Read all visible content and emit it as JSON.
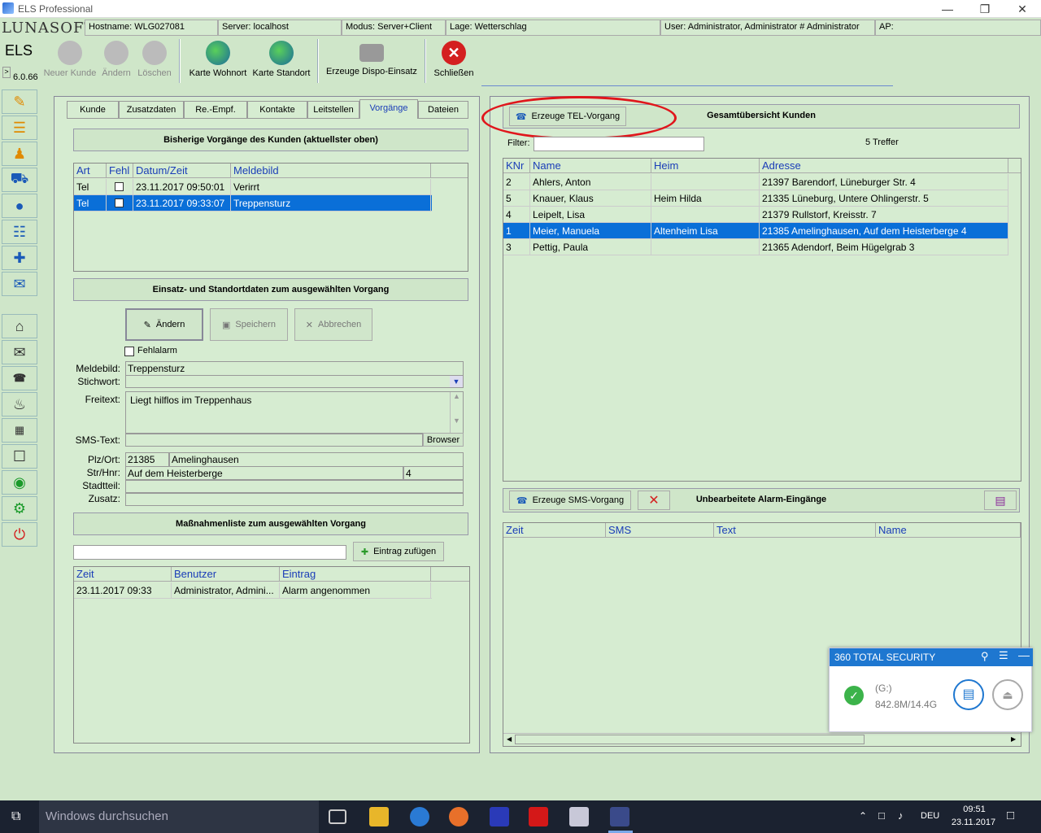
{
  "window": {
    "title": "ELS Professional"
  },
  "info": {
    "logo": "LUNASOFT",
    "hostname": "Hostname: WLG027081",
    "server": "Server: localhost",
    "modus": "Modus: Server+Client",
    "lage": "Lage: Wetterschlag",
    "user": "User: Administrator, Administrator # Administrator",
    "ap": "AP:"
  },
  "app": {
    "name": "ELS",
    "version": "6.0.66",
    "arrow": ">"
  },
  "toolbar": {
    "neuer_kunde": "Neuer Kunde",
    "aendern": "Ändern",
    "loeschen": "Löschen",
    "karte_wohnort": "Karte Wohnort",
    "karte_standort": "Karte Standort",
    "dispo": "Erzeuge Dispo-Einsatz",
    "schliessen": "Schließen"
  },
  "tabs": [
    "Kunde",
    "Zusatzdaten",
    "Re.-Empf.",
    "Kontakte",
    "Leitstellen",
    "Vorgänge",
    "Dateien"
  ],
  "vorgaenge": {
    "title": "Bisherige Vorgänge des Kunden (aktuellster oben)",
    "cols": [
      "Art",
      "Fehl",
      "Datum/Zeit",
      "Meldebild"
    ],
    "rows": [
      {
        "art": "Tel",
        "datum": "23.11.2017 09:50:01",
        "meldebild": "Verirrt"
      },
      {
        "art": "Tel",
        "datum": "23.11.2017 09:33:07",
        "meldebild": "Treppensturz"
      }
    ]
  },
  "einsatz": {
    "title": "Einsatz- und Standortdaten zum ausgewählten Vorgang",
    "aendern": "Ändern",
    "speichern": "Speichern",
    "abbrechen": "Abbrechen",
    "fehlalarm": "Fehlalarm",
    "meldebild_label": "Meldebild:",
    "meldebild": "Treppensturz",
    "stichwort_label": "Stichwort:",
    "freitext_label": "Freitext:",
    "freitext": "Liegt hilflos im Treppenhaus",
    "sms_label": "SMS-Text:",
    "browser": "Browser",
    "plz_label": "Plz/Ort:",
    "plz": "21385",
    "ort": "Amelinghausen",
    "str_label": "Str/Hnr:",
    "str": "Auf dem Heisterberge",
    "hnr": "4",
    "stadtteil_label": "Stadtteil:",
    "zusatz_label": "Zusatz:"
  },
  "massnahmen": {
    "title": "Maßnahmenliste zum ausgewählten Vorgang",
    "add": "Eintrag zufügen",
    "cols": [
      "Zeit",
      "Benutzer",
      "Eintrag"
    ],
    "rows": [
      {
        "zeit": "23.11.2017 09:33",
        "benutzer": "Administrator, Admini...",
        "eintrag": "Alarm angenommen"
      }
    ]
  },
  "uebersicht": {
    "tel_button": "Erzeuge TEL-Vorgang",
    "title": "Gesamtübersicht Kunden",
    "filter_label": "Filter:",
    "treffer": "5 Treffer",
    "cols": [
      "KNr",
      "Name",
      "Heim",
      "Adresse"
    ],
    "rows": [
      {
        "knr": "2",
        "name": "Ahlers, Anton",
        "heim": "",
        "adresse": "21397 Barendorf, Lüneburger Str. 4"
      },
      {
        "knr": "5",
        "name": "Knauer, Klaus",
        "heim": "Heim Hilda",
        "adresse": "21335 Lüneburg, Untere Ohlingerstr. 5"
      },
      {
        "knr": "4",
        "name": "Leipelt, Lisa",
        "heim": "",
        "adresse": "21379 Rullstorf, Kreisstr. 7"
      },
      {
        "knr": "1",
        "name": "Meier, Manuela",
        "heim": "Altenheim Lisa",
        "adresse": "21385 Amelinghausen, Auf dem Heisterberge 4"
      },
      {
        "knr": "3",
        "name": "Pettig, Paula",
        "heim": "",
        "adresse": "21365 Adendorf, Beim Hügelgrab 3"
      }
    ]
  },
  "alarm": {
    "sms_button": "Erzeuge SMS-Vorgang",
    "title": "Unbearbeitete Alarm-Eingänge",
    "cols": [
      "Zeit",
      "SMS",
      "Text",
      "Name"
    ]
  },
  "security": {
    "title": "360 TOTAL SECURITY",
    "drive": "(G:)",
    "size": "842.8M/14.4G"
  },
  "taskbar": {
    "search": "Windows durchsuchen",
    "lang": "DEU",
    "time": "09:51",
    "date": "23.11.2017"
  },
  "colors": {
    "highlight": "#0a6fd8",
    "header_text": "#1a3db8",
    "annotation": "#e0161c"
  }
}
